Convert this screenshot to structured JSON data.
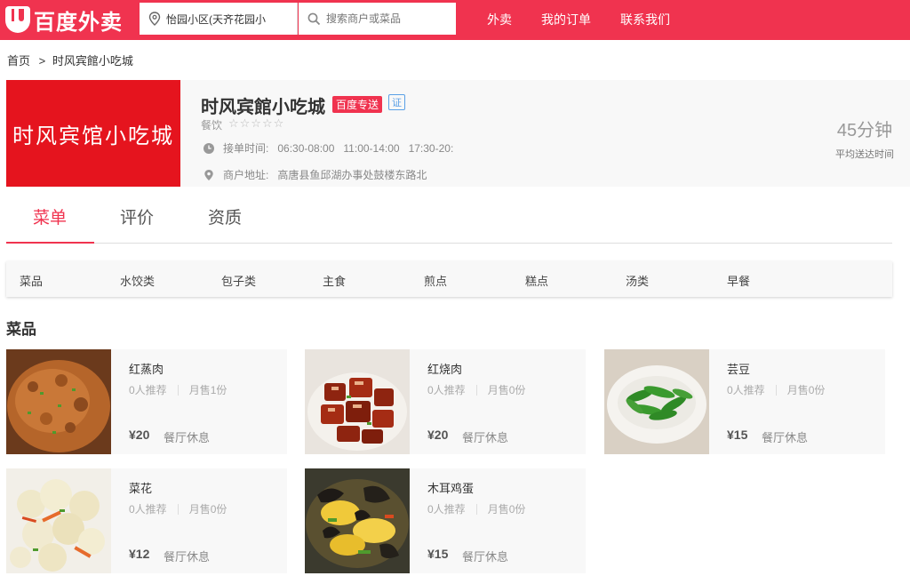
{
  "header": {
    "logo_text": "百度外卖",
    "address": "怡园小区(天齐花园小",
    "search_placeholder": "搜索商户或菜品",
    "nav": [
      "外卖",
      "我的订单",
      "联系我们"
    ]
  },
  "breadcrumb": {
    "home": "首页",
    "separator": ">",
    "current": "时风宾館小吃城"
  },
  "shop": {
    "logo_text": "时风宾馆小吃城",
    "name": "时风宾館小吃城",
    "tag": "百度专送",
    "cert": "证",
    "category": "餐饮",
    "stars": "☆☆☆☆☆",
    "hours_label": "接单时间:",
    "hours": "06:30-08:00   11:00-14:00   17:30-20:",
    "address_label": "商户地址:",
    "address": "高唐县鱼邱湖办事处鼓楼东路北",
    "delivery_time": "45分钟",
    "delivery_label": "平均送达时间"
  },
  "tabs": [
    "菜单",
    "评价",
    "资质"
  ],
  "categories": [
    "菜品",
    "水饺类",
    "包子类",
    "主食",
    "煎点",
    "糕点",
    "汤类",
    "早餐"
  ],
  "section_title": "菜品",
  "dishes": [
    {
      "name": "红蒸肉",
      "recommend": "0人推荐",
      "sales": "月售1份",
      "price": "¥20",
      "status": "餐厅休息"
    },
    {
      "name": "红烧肉",
      "recommend": "0人推荐",
      "sales": "月售0份",
      "price": "¥20",
      "status": "餐厅休息"
    },
    {
      "name": "芸豆",
      "recommend": "0人推荐",
      "sales": "月售0份",
      "price": "¥15",
      "status": "餐厅休息"
    },
    {
      "name": "菜花",
      "recommend": "0人推荐",
      "sales": "月售0份",
      "price": "¥12",
      "status": "餐厅休息"
    },
    {
      "name": "木耳鸡蛋",
      "recommend": "0人推荐",
      "sales": "月售0份",
      "price": "¥15",
      "status": "餐厅休息"
    }
  ],
  "colors": {
    "brand": "#f0334f",
    "logo_bg": "#e5141e"
  }
}
